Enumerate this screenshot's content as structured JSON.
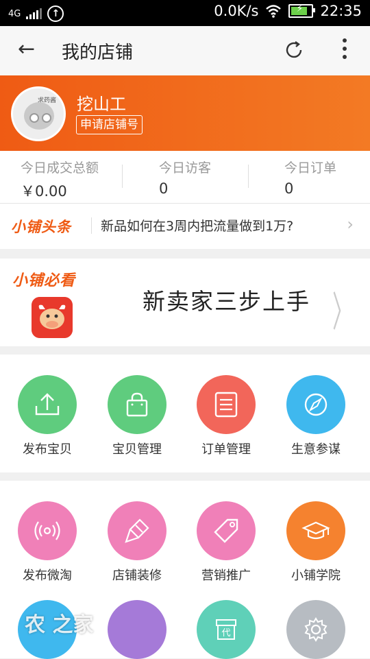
{
  "status_bar": {
    "network": "4G",
    "speed": "0.0K/s",
    "time": "22:35"
  },
  "header": {
    "title": "我的店铺",
    "back_icon": "back-arrow-icon",
    "refresh_icon": "refresh-icon",
    "more_icon": "more-vertical-icon"
  },
  "profile": {
    "avatar_tag": "求药酱",
    "shop_name": "挖山工",
    "apply_button": "申请店铺号",
    "bg_color": "#f06a1c"
  },
  "stats": [
    {
      "label": "今日成交总额",
      "value": "￥0.00"
    },
    {
      "label": "今日访客",
      "value": "0"
    },
    {
      "label": "今日订单",
      "value": "0"
    }
  ],
  "headline": {
    "brand": "小铺头条",
    "text": "新品如何在3周内把流量做到1万?"
  },
  "must_read": {
    "brand": "小铺必看",
    "text": "新卖家三步上手"
  },
  "grid1": [
    {
      "label": "发布宝贝",
      "color": "#5fcc7e",
      "icon": "upload-icon"
    },
    {
      "label": "宝贝管理",
      "color": "#5fcc7e",
      "icon": "shopping-bag-icon"
    },
    {
      "label": "订单管理",
      "color": "#f2665a",
      "icon": "order-list-icon"
    },
    {
      "label": "生意参谋",
      "color": "#3fb8ee",
      "icon": "compass-icon"
    }
  ],
  "grid2": [
    {
      "label": "发布微淘",
      "color": "#f080b8",
      "icon": "broadcast-icon"
    },
    {
      "label": "店铺装修",
      "color": "#f080b8",
      "icon": "paint-brush-icon"
    },
    {
      "label": "营销推广",
      "color": "#f080b8",
      "icon": "price-tag-icon"
    },
    {
      "label": "小铺学院",
      "color": "#f5822f",
      "icon": "graduation-cap-icon"
    },
    {
      "label": "",
      "color": "#3fb8ee",
      "icon": "app-icon"
    },
    {
      "label": "",
      "color": "#a57ad8",
      "icon": "app-icon"
    },
    {
      "label": "",
      "color": "#5fd0b8",
      "icon": "agent-box-icon",
      "glyph": "代"
    },
    {
      "label": "",
      "color": "#b7bcc2",
      "icon": "settings-gear-icon"
    }
  ],
  "watermark": "农 之家"
}
